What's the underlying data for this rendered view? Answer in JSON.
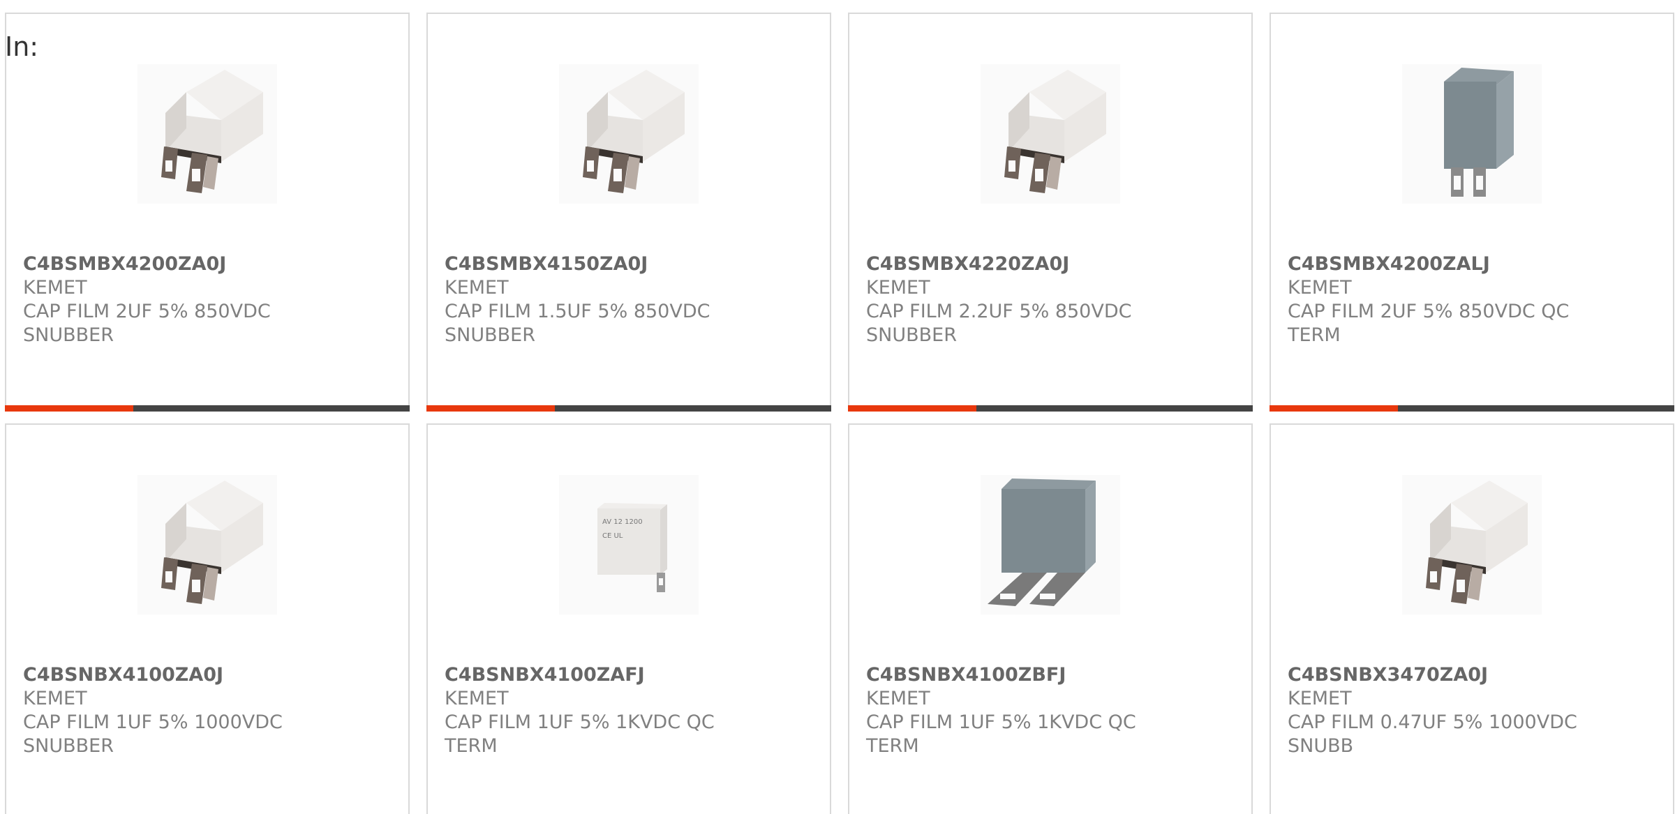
{
  "header": {
    "in_label": "In:"
  },
  "colors": {
    "accent": "#e8380d",
    "bar_dark": "#444444",
    "border": "#d9d9d9"
  },
  "products": [
    {
      "part": "C4BSMBX4200ZA0J",
      "maker": "KEMET",
      "desc_line1": "CAP FILM 2UF 5% 850VDC",
      "desc_line2": "SNUBBER",
      "image": "white-capacitor-icon"
    },
    {
      "part": "C4BSMBX4150ZA0J",
      "maker": "KEMET",
      "desc_line1": "CAP FILM 1.5UF 5% 850VDC",
      "desc_line2": "SNUBBER",
      "image": "white-capacitor-icon"
    },
    {
      "part": "C4BSMBX4220ZA0J",
      "maker": "KEMET",
      "desc_line1": "CAP FILM 2.2UF 5% 850VDC",
      "desc_line2": "SNUBBER",
      "image": "white-capacitor-icon"
    },
    {
      "part": "C4BSMBX4200ZALJ",
      "maker": "KEMET",
      "desc_line1": "CAP FILM 2UF 5% 850VDC QC",
      "desc_line2": "TERM",
      "image": "gray-capacitor-upright-icon"
    },
    {
      "part": "C4BSNBX4100ZA0J",
      "maker": "KEMET",
      "desc_line1": "CAP FILM 1UF 5% 1000VDC",
      "desc_line2": "SNUBBER",
      "image": "white-capacitor-icon"
    },
    {
      "part": "C4BSNBX4100ZAFJ",
      "maker": "KEMET",
      "desc_line1": "CAP FILM 1UF 5% 1KVDC QC",
      "desc_line2": "TERM",
      "image": "small-white-capacitor-icon"
    },
    {
      "part": "C4BSNBX4100ZBFJ",
      "maker": "KEMET",
      "desc_line1": "CAP FILM 1UF 5% 1KVDC QC",
      "desc_line2": "TERM",
      "image": "gray-capacitor-flat-icon"
    },
    {
      "part": "C4BSNBX3470ZA0J",
      "maker": "KEMET",
      "desc_line1": "CAP FILM 0.47UF 5% 1000VDC",
      "desc_line2": "SNUBB",
      "image": "white-capacitor-icon"
    }
  ]
}
